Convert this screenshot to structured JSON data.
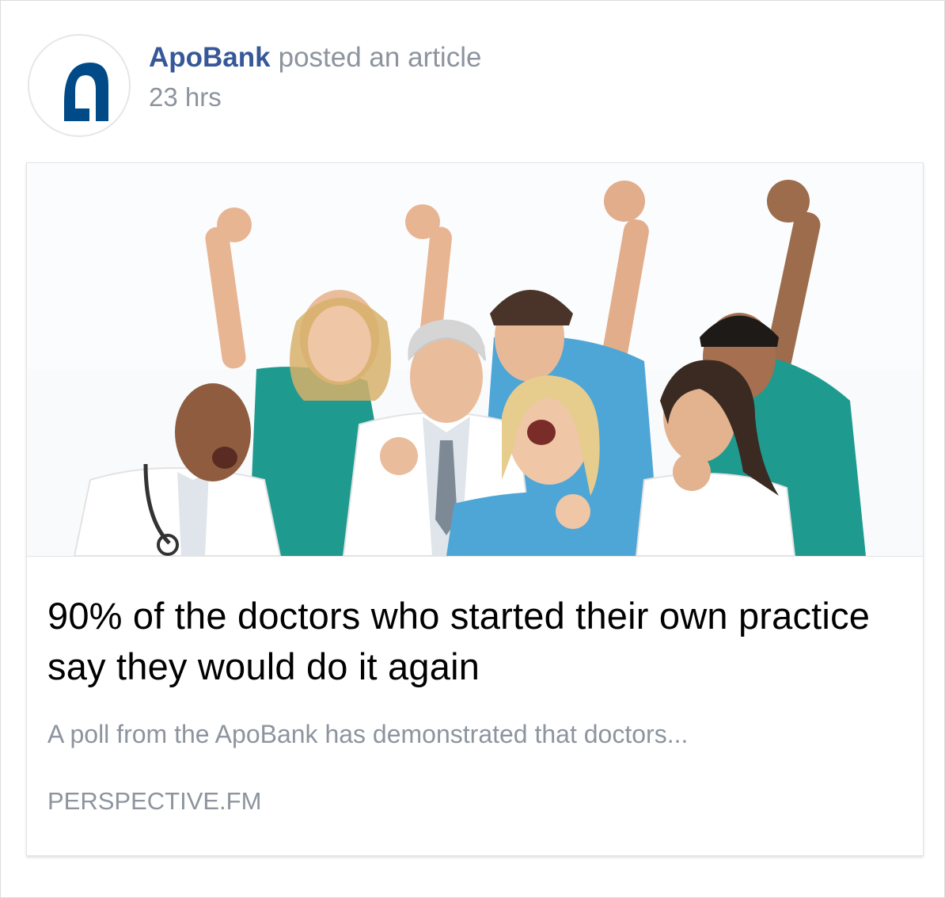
{
  "post": {
    "author": "ApoBank",
    "action": "posted an article",
    "timestamp": "23 hrs"
  },
  "article": {
    "headline": "90% of the doctors who started their own practice say they would do it again",
    "summary": "A poll from the ApoBank has demonstrated that doctors...",
    "source": "PERSPECTIVE.FM"
  },
  "icons": {
    "avatar": "apobank-logo-icon"
  },
  "colors": {
    "author_link": "#365899",
    "meta_text": "#8d949e",
    "brand_blue": "#004b87",
    "scrubs_teal": "#1f9a8f",
    "scrubs_blue": "#4ea6d6"
  }
}
